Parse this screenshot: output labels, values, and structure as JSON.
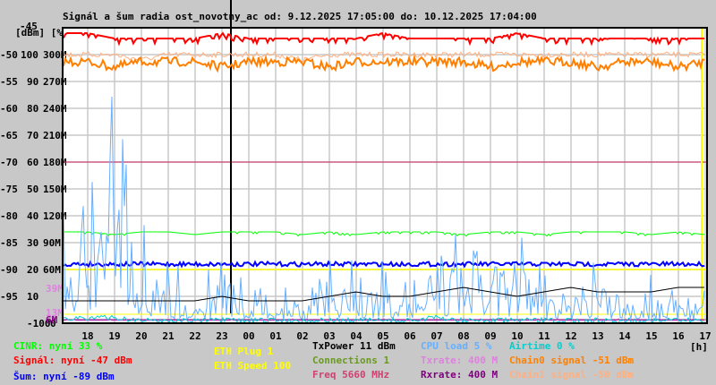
{
  "chart_data": {
    "type": "line",
    "title": "Signál a šum radia ost_novotny_ac od: 9.12.2025 17:05:00 do: 10.12.2025 17:04:00",
    "ylabel": "[dBm] [%]",
    "xlabel": "[h]",
    "x_ticks": [
      "18",
      "19",
      "20",
      "21",
      "22",
      "23",
      "00",
      "01",
      "02",
      "03",
      "04",
      "05",
      "06",
      "07",
      "08",
      "09",
      "10",
      "11",
      "12",
      "13",
      "14",
      "15",
      "16",
      "17"
    ],
    "y_ticks_dbm": [
      "-45",
      "-50",
      "-55",
      "-60",
      "-65",
      "-70",
      "-75",
      "-80",
      "-85",
      "-90",
      "-95",
      "-100"
    ],
    "y_ticks_pct": [
      "100",
      "90",
      "80",
      "70",
      "60",
      "50",
      "40",
      "30",
      "20",
      "10",
      "0"
    ],
    "y_ticks_rate": [
      "300M",
      "270M",
      "240M",
      "210M",
      "180M",
      "150M",
      "120M",
      "90M",
      "60M"
    ],
    "y_ticks_rate_small": [
      "39M",
      "13M",
      "6M"
    ],
    "ylim": [
      -100,
      -45
    ],
    "grid": true,
    "series": [
      {
        "name": "Signál",
        "color": "#ff0000",
        "hourly": [
          -46,
          -47,
          -47,
          -47,
          -47,
          -46,
          -47,
          -47,
          -47,
          -47,
          -47,
          -46,
          -47,
          -47,
          -47,
          -47,
          -46,
          -47,
          -47,
          -47,
          -47,
          -47,
          -47,
          -47
        ]
      },
      {
        "name": "Chain1 signal",
        "color": "#ffb080",
        "hourly": [
          -50,
          -50,
          -51,
          -50,
          -50,
          -50,
          -50,
          -50,
          -51,
          -50,
          -50,
          -50,
          -50,
          -50,
          -50,
          -50,
          -50,
          -50,
          -50,
          -50,
          -50,
          -50,
          -50,
          -50
        ]
      },
      {
        "name": "Chain0 signal",
        "color": "#ff8000",
        "hourly": [
          -51,
          -52,
          -51,
          -51,
          -51,
          -52,
          -51,
          -51,
          -51,
          -52,
          -51,
          -51,
          -51,
          -51,
          -51,
          -52,
          -51,
          -51,
          -51,
          -52,
          -51,
          -51,
          -52,
          -51
        ]
      },
      {
        "name": "Šum",
        "color": "#0000ff",
        "hourly": [
          -89,
          -89,
          -89,
          -89,
          -89,
          -89,
          -89,
          -89,
          -89,
          -89,
          -89,
          -89,
          -89,
          -89,
          -89,
          -89,
          -89,
          -89,
          -89,
          -89,
          -89,
          -89,
          -89,
          -89
        ]
      },
      {
        "name": "CINR",
        "color": "#00ff00",
        "hourly": [
          34,
          33,
          34,
          34,
          33,
          34,
          34,
          34,
          33,
          34,
          33,
          34,
          34,
          34,
          33,
          34,
          34,
          33,
          34,
          34,
          34,
          33,
          34,
          33
        ]
      },
      {
        "name": "CPU load",
        "color": "#66b0ff",
        "hourly": [
          20,
          40,
          15,
          8,
          6,
          9,
          5,
          6,
          5,
          12,
          7,
          10,
          6,
          9,
          14,
          10,
          12,
          9,
          8,
          10,
          7,
          6,
          5,
          5
        ]
      },
      {
        "name": "Txrate",
        "color": "#e080e0",
        "hourly": [
          400,
          400,
          400,
          400,
          400,
          400,
          400,
          400,
          400,
          400,
          400,
          400,
          400,
          400,
          400,
          400,
          400,
          400,
          400,
          400,
          400,
          400,
          400,
          400
        ]
      },
      {
        "name": "Rxrate",
        "color": "#800080",
        "hourly": [
          400,
          400,
          400,
          400,
          400,
          400,
          400,
          400,
          400,
          400,
          400,
          400,
          400,
          400,
          400,
          400,
          400,
          400,
          400,
          400,
          400,
          400,
          400,
          400
        ]
      },
      {
        "name": "Airtime",
        "color": "#00d0d0",
        "hourly": [
          2,
          2,
          1,
          1,
          1,
          1,
          1,
          1,
          1,
          1,
          1,
          1,
          1,
          2,
          1,
          1,
          1,
          1,
          1,
          1,
          1,
          1,
          1,
          1
        ]
      },
      {
        "name": "Connections",
        "color": "#000000",
        "hourly": [
          3,
          3,
          3,
          3,
          3,
          4,
          3,
          3,
          3,
          4,
          5,
          4,
          4,
          5,
          6,
          5,
          4,
          5,
          6,
          5,
          5,
          5,
          6,
          6
        ]
      }
    ],
    "reference_lines": [
      {
        "name": "Freq",
        "color": "#d02060",
        "level_dbm": -70
      },
      {
        "name": "ETH Speed",
        "color": "#ffff00",
        "level_dbm": -90
      }
    ]
  },
  "legend": {
    "cinr": "CINR: nyní 33 %",
    "signal": "Signál: nyní -47 dBm",
    "noise": "Šum: nyní -89 dBm",
    "eth_plug": "ETH Plug 1",
    "eth_speed": "ETH Speed 100",
    "txpower": "TxPower 11 dBm",
    "connections": "Connections 1",
    "freq": "Freq 5660 MHz",
    "cpu": "CPU load 5 %",
    "txrate": "Txrate: 400 M",
    "rxrate": "Rxrate: 400 M",
    "airtime": "Airtime 0 %",
    "chain0": "Chain0 signal -51 dBm",
    "chain1": "Chain1 signal -50 dBm"
  }
}
